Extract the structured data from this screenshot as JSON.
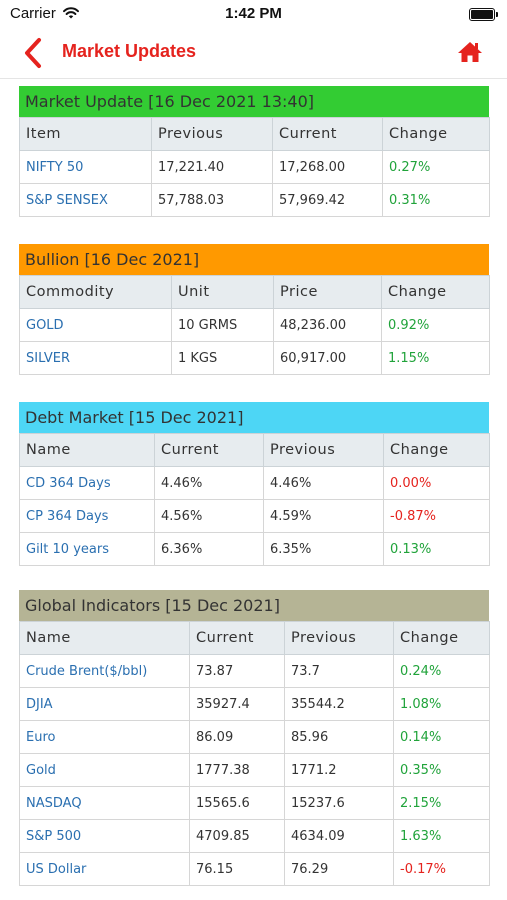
{
  "status": {
    "carrier": "Carrier",
    "time": "1:42 PM"
  },
  "nav": {
    "title": "Market Updates"
  },
  "colors": {
    "accent": "#e5231e",
    "market_header": "#33cc33",
    "bullion_header": "#ff9900",
    "debt_header": "#4dd6f5",
    "global_header": "#b5b495",
    "positive": "#20a33a",
    "negative": "#e5231e",
    "link": "#2a6fb0"
  },
  "market": {
    "title": "Market Update [16 Dec 2021 13:40]",
    "columns": [
      "Item",
      "Previous",
      "Current",
      "Change"
    ],
    "rows": [
      [
        "NIFTY 50",
        "17,221.40",
        "17,268.00",
        "0.27%"
      ],
      [
        "S&P SENSEX",
        "57,788.03",
        "57,969.42",
        "0.31%"
      ]
    ]
  },
  "bullion": {
    "title": "Bullion [16 Dec 2021]",
    "columns": [
      "Commodity",
      "Unit",
      "Price",
      "Change"
    ],
    "rows": [
      [
        "GOLD",
        "10 GRMS",
        "48,236.00",
        "0.92%"
      ],
      [
        "SILVER",
        "1 KGS",
        "60,917.00",
        "1.15%"
      ]
    ]
  },
  "debt": {
    "title": "Debt Market [15 Dec 2021]",
    "columns": [
      "Name",
      "Current",
      "Previous",
      "Change"
    ],
    "rows": [
      [
        "CD 364 Days",
        "4.46%",
        "4.46%",
        "0.00%"
      ],
      [
        "CP 364 Days",
        "4.56%",
        "4.59%",
        "-0.87%"
      ],
      [
        "Gilt 10 years",
        "6.36%",
        "6.35%",
        "0.13%"
      ]
    ]
  },
  "global": {
    "title": "Global Indicators [15 Dec 2021]",
    "columns": [
      "Name",
      "Current",
      "Previous",
      "Change"
    ],
    "rows": [
      [
        "Crude Brent($/bbl)",
        "73.87",
        "73.7",
        "0.24%"
      ],
      [
        "DJIA",
        "35927.4",
        "35544.2",
        "1.08%"
      ],
      [
        "Euro",
        "86.09",
        "85.96",
        "0.14%"
      ],
      [
        "Gold",
        "1777.38",
        "1771.2",
        "0.35%"
      ],
      [
        "NASDAQ",
        "15565.6",
        "15237.6",
        "2.15%"
      ],
      [
        "S&P 500",
        "4709.85",
        "4634.09",
        "1.63%"
      ],
      [
        "US Dollar",
        "76.15",
        "76.29",
        "-0.17%"
      ]
    ]
  }
}
